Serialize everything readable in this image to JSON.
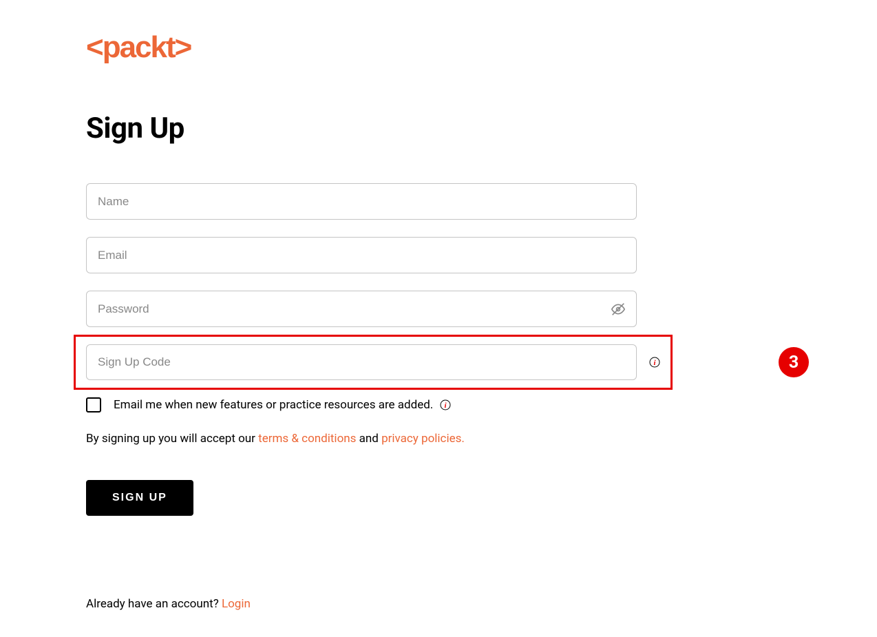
{
  "brand": {
    "name": "packt",
    "color": "#ec6737"
  },
  "page": {
    "title": "Sign Up"
  },
  "form": {
    "name_placeholder": "Name",
    "email_placeholder": "Email",
    "password_placeholder": "Password",
    "signup_code_placeholder": "Sign Up Code"
  },
  "checkbox": {
    "label": "Email me when new features or practice resources are added."
  },
  "terms": {
    "prefix": "By signing up you will accept our ",
    "terms_link": "terms & conditions",
    "connector": " and ",
    "privacy_link": "privacy policies."
  },
  "button": {
    "signup_label": "SIGN UP"
  },
  "footer": {
    "question": "Already have an account? ",
    "login_link": "Login"
  },
  "annotation": {
    "step_number": "3"
  }
}
